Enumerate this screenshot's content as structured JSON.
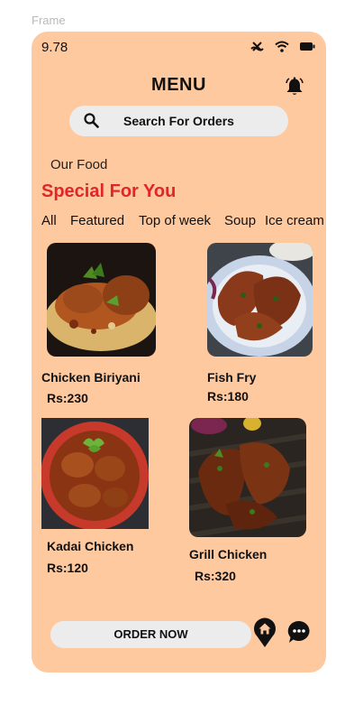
{
  "frame_label": "Frame",
  "status_bar": {
    "time": "9.78",
    "icons": [
      "no-signal-icon",
      "wifi-icon",
      "battery-icon"
    ]
  },
  "header": {
    "title": "MENU",
    "notification_icon": "bell-icon"
  },
  "search": {
    "placeholder": "Search For Orders",
    "icon": "search-icon"
  },
  "section": {
    "label": "Our Food",
    "heading": "Special For You"
  },
  "tabs": [
    {
      "label": "All"
    },
    {
      "label": "Featured"
    },
    {
      "label": "Top of week"
    },
    {
      "label": "Soup"
    },
    {
      "label": "Ice cream"
    }
  ],
  "foods": [
    {
      "name": "Chicken Biriyani",
      "price": "Rs:230"
    },
    {
      "name": "Fish Fry",
      "price": "Rs:180"
    },
    {
      "name": "Kadai Chicken",
      "price": "Rs:120"
    },
    {
      "name": "Grill Chicken",
      "price": "Rs:320"
    }
  ],
  "bottom": {
    "order_label": "ORDER NOW",
    "home_icon": "home-pin-icon",
    "chat_icon": "chat-icon"
  },
  "colors": {
    "background": "#ffc9a0",
    "accent": "#e02626",
    "pill": "#ececed"
  }
}
